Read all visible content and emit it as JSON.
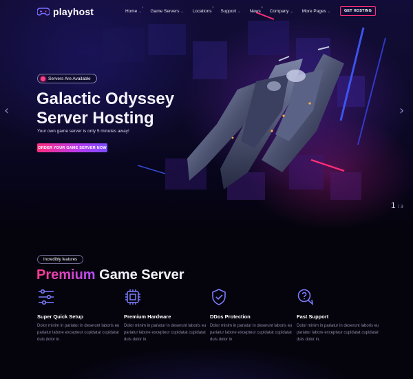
{
  "brand": {
    "name": "playhost"
  },
  "nav": {
    "items": [
      {
        "label": "Home",
        "num": "1",
        "dropdown": true
      },
      {
        "label": "Game Servers",
        "num": "",
        "dropdown": true
      },
      {
        "label": "Locations",
        "num": "2",
        "dropdown": false
      },
      {
        "label": "Support",
        "num": "",
        "dropdown": true
      },
      {
        "label": "News",
        "num": "5",
        "dropdown": false
      },
      {
        "label": "Company",
        "num": "",
        "dropdown": true
      },
      {
        "label": "More Pages",
        "num": "",
        "dropdown": true
      }
    ],
    "cta": "GET HOSTING"
  },
  "hero": {
    "badge": "Servers Are Available",
    "title_line1": "Galactic Odyssey",
    "title_line2": "Server Hosting",
    "subtitle": "Your own game server is only 5 minutes away!",
    "button": "ORDER YOUR GAME SERVER NOW",
    "slide_current": "1",
    "slide_total": "/ 3",
    "prev_icon": "chevron-left-icon",
    "next_icon": "chevron-right-icon"
  },
  "features": {
    "tagline": "Incredibly features",
    "title_highlight": "Premium",
    "title_rest": "Game Server",
    "items": [
      {
        "icon": "sliders-icon",
        "title": "Super Quick Setup",
        "desc": "Dolor minim in pariatur in deserunt laboris eu pariatur labore excepteur cupidatat cupidatat duis dolor in."
      },
      {
        "icon": "cpu-chip-icon",
        "title": "Premium Hardware",
        "desc": "Dolor minim in pariatur in deserunt laboris eu pariatur labore excepteur cupidatat cupidatat duis dolor in."
      },
      {
        "icon": "shield-check-icon",
        "title": "DDos Protection",
        "desc": "Dolor minim in pariatur in deserunt laboris eu pariatur labore excepteur cupidatat cupidatat duis dolor in."
      },
      {
        "icon": "chat-question-icon",
        "title": "Fast Support",
        "desc": "Dolor minim in pariatur in deserunt laboris eu pariatur labore excepteur cupidatat cupidatat duis dolor in."
      }
    ]
  },
  "colors": {
    "accent_pink": "#ff2d75",
    "accent_purple": "#b54cff",
    "icon_blue": "#7d7dff",
    "background": "#05040d"
  }
}
